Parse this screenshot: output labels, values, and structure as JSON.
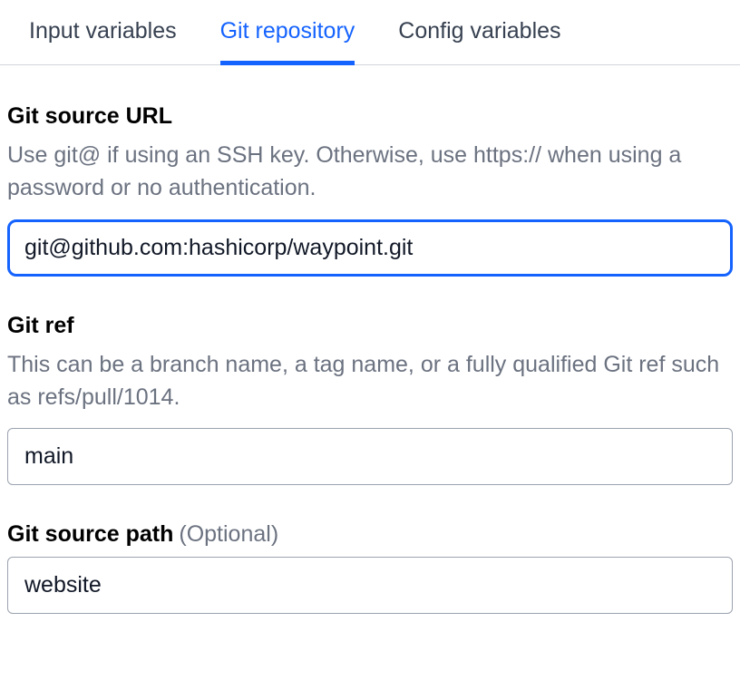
{
  "tabs": [
    {
      "label": "Input variables",
      "active": false
    },
    {
      "label": "Git repository",
      "active": true
    },
    {
      "label": "Config variables",
      "active": false
    }
  ],
  "fields": {
    "gitSourceUrl": {
      "label": "Git source URL",
      "description": "Use git@ if using an SSH key. Otherwise, use https:// when using a password or no authentication.",
      "value": "git@github.com:hashicorp/waypoint.git"
    },
    "gitRef": {
      "label": "Git ref",
      "description": "This can be a branch name, a tag name, or a fully qualified Git ref such as refs/pull/1014.",
      "value": "main"
    },
    "gitSourcePath": {
      "label": "Git source path",
      "suffix": "(Optional)",
      "value": "website"
    }
  }
}
